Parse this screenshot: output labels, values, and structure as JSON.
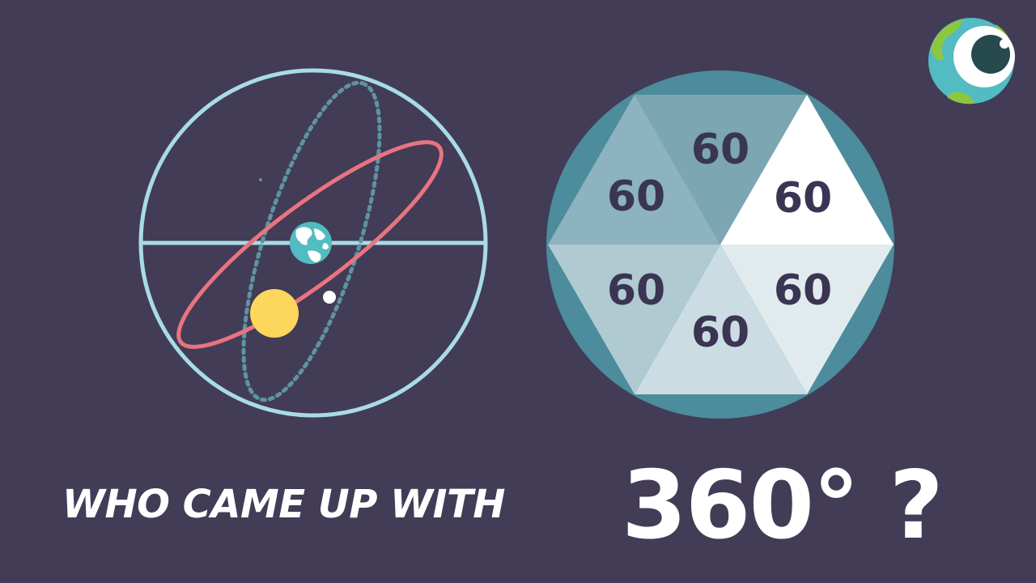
{
  "slice_labels": [
    "60",
    "60",
    "60",
    "60",
    "60",
    "60"
  ],
  "title": {
    "question": "WHO CAME UP WITH",
    "degrees": "360° ?"
  },
  "colors": {
    "background": "#423c57",
    "celestial_sphere": "#a9dbe6",
    "ecliptic": "#e97480",
    "orbit_dotted": "#5f93a1",
    "sun": "#fdd65c",
    "earth_water": "#52bcc2",
    "hexagon_circle": "#4c8c9c",
    "logo_eye": "#264a4e"
  }
}
